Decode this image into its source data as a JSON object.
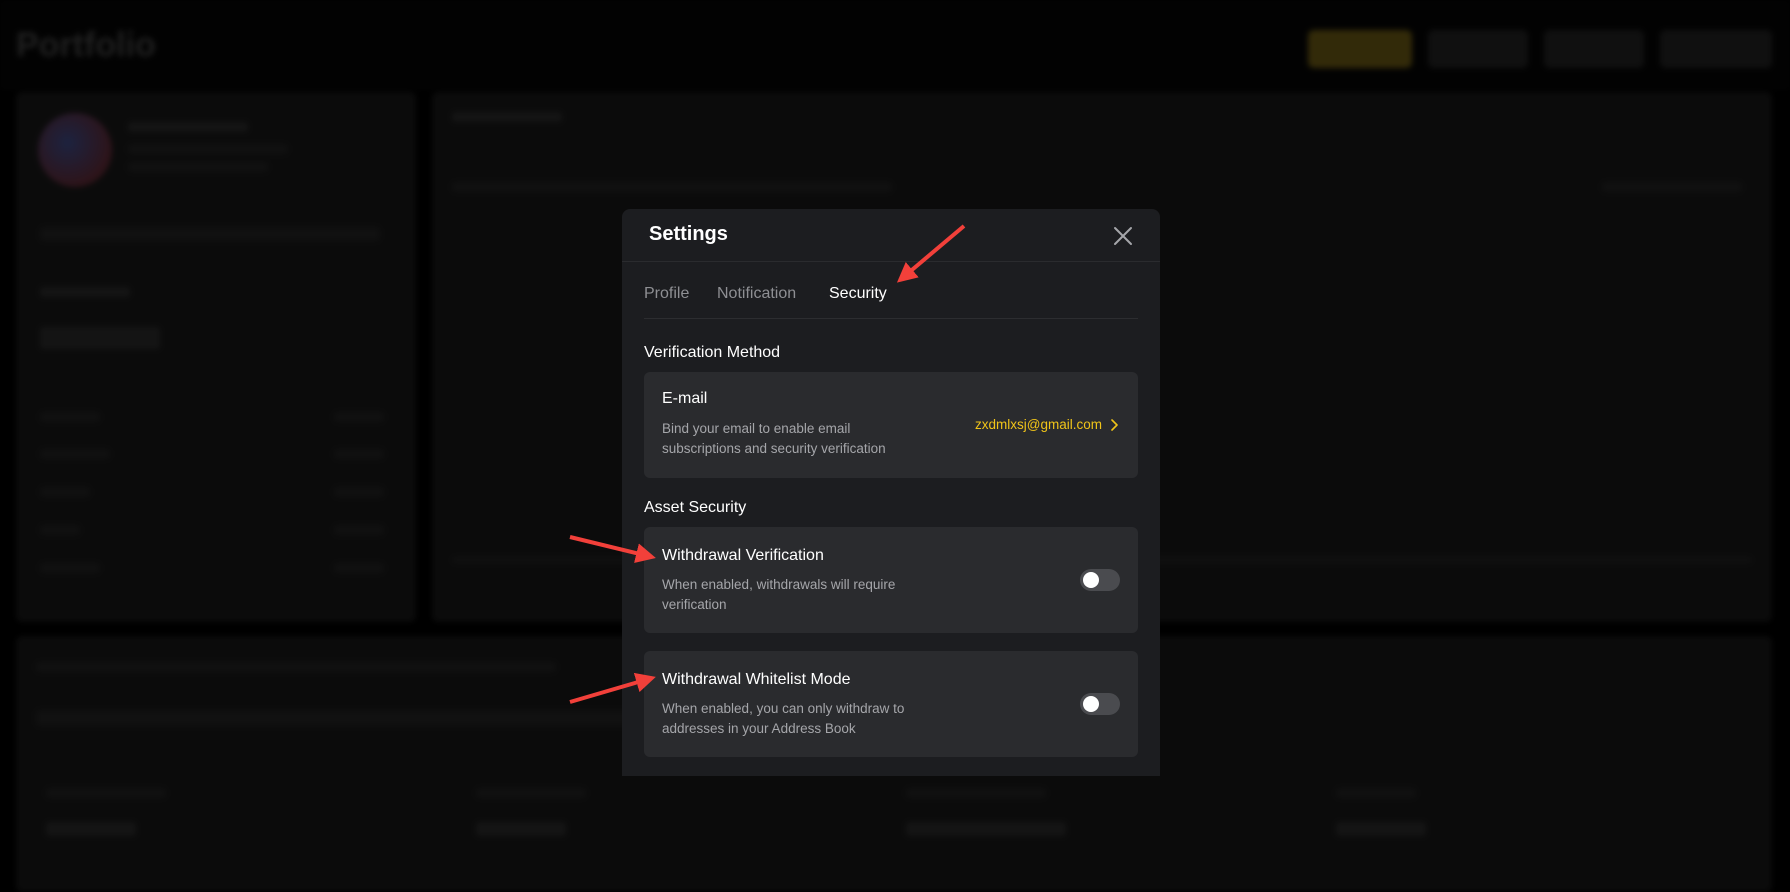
{
  "background": {
    "app_title": "Portfolio"
  },
  "modal": {
    "title": "Settings",
    "tabs": [
      {
        "label": "Profile",
        "active": false
      },
      {
        "label": "Notification",
        "active": false
      },
      {
        "label": "Security",
        "active": true
      }
    ],
    "verification_section": {
      "label": "Verification Method",
      "email_card": {
        "title": "E-mail",
        "description": "Bind your email to enable email subscriptions and security verification",
        "value": "zxdmlxsj@gmail.com"
      }
    },
    "asset_security_section": {
      "label": "Asset Security",
      "withdrawal_verification": {
        "title": "Withdrawal Verification",
        "description": "When enabled, withdrawals will require verification",
        "enabled": false
      },
      "whitelist_mode": {
        "title": "Withdrawal Whitelist Mode",
        "description": "When enabled, you can only withdraw to addresses in your Address Book",
        "enabled": false
      }
    }
  },
  "colors": {
    "accent": "#f0c419",
    "annotation_arrow": "#f2403a",
    "modal_bg": "#1c1d20",
    "card_bg": "#2a2b2e"
  },
  "icons": {
    "close": "close-icon",
    "chevron": "chevron-right-icon"
  }
}
